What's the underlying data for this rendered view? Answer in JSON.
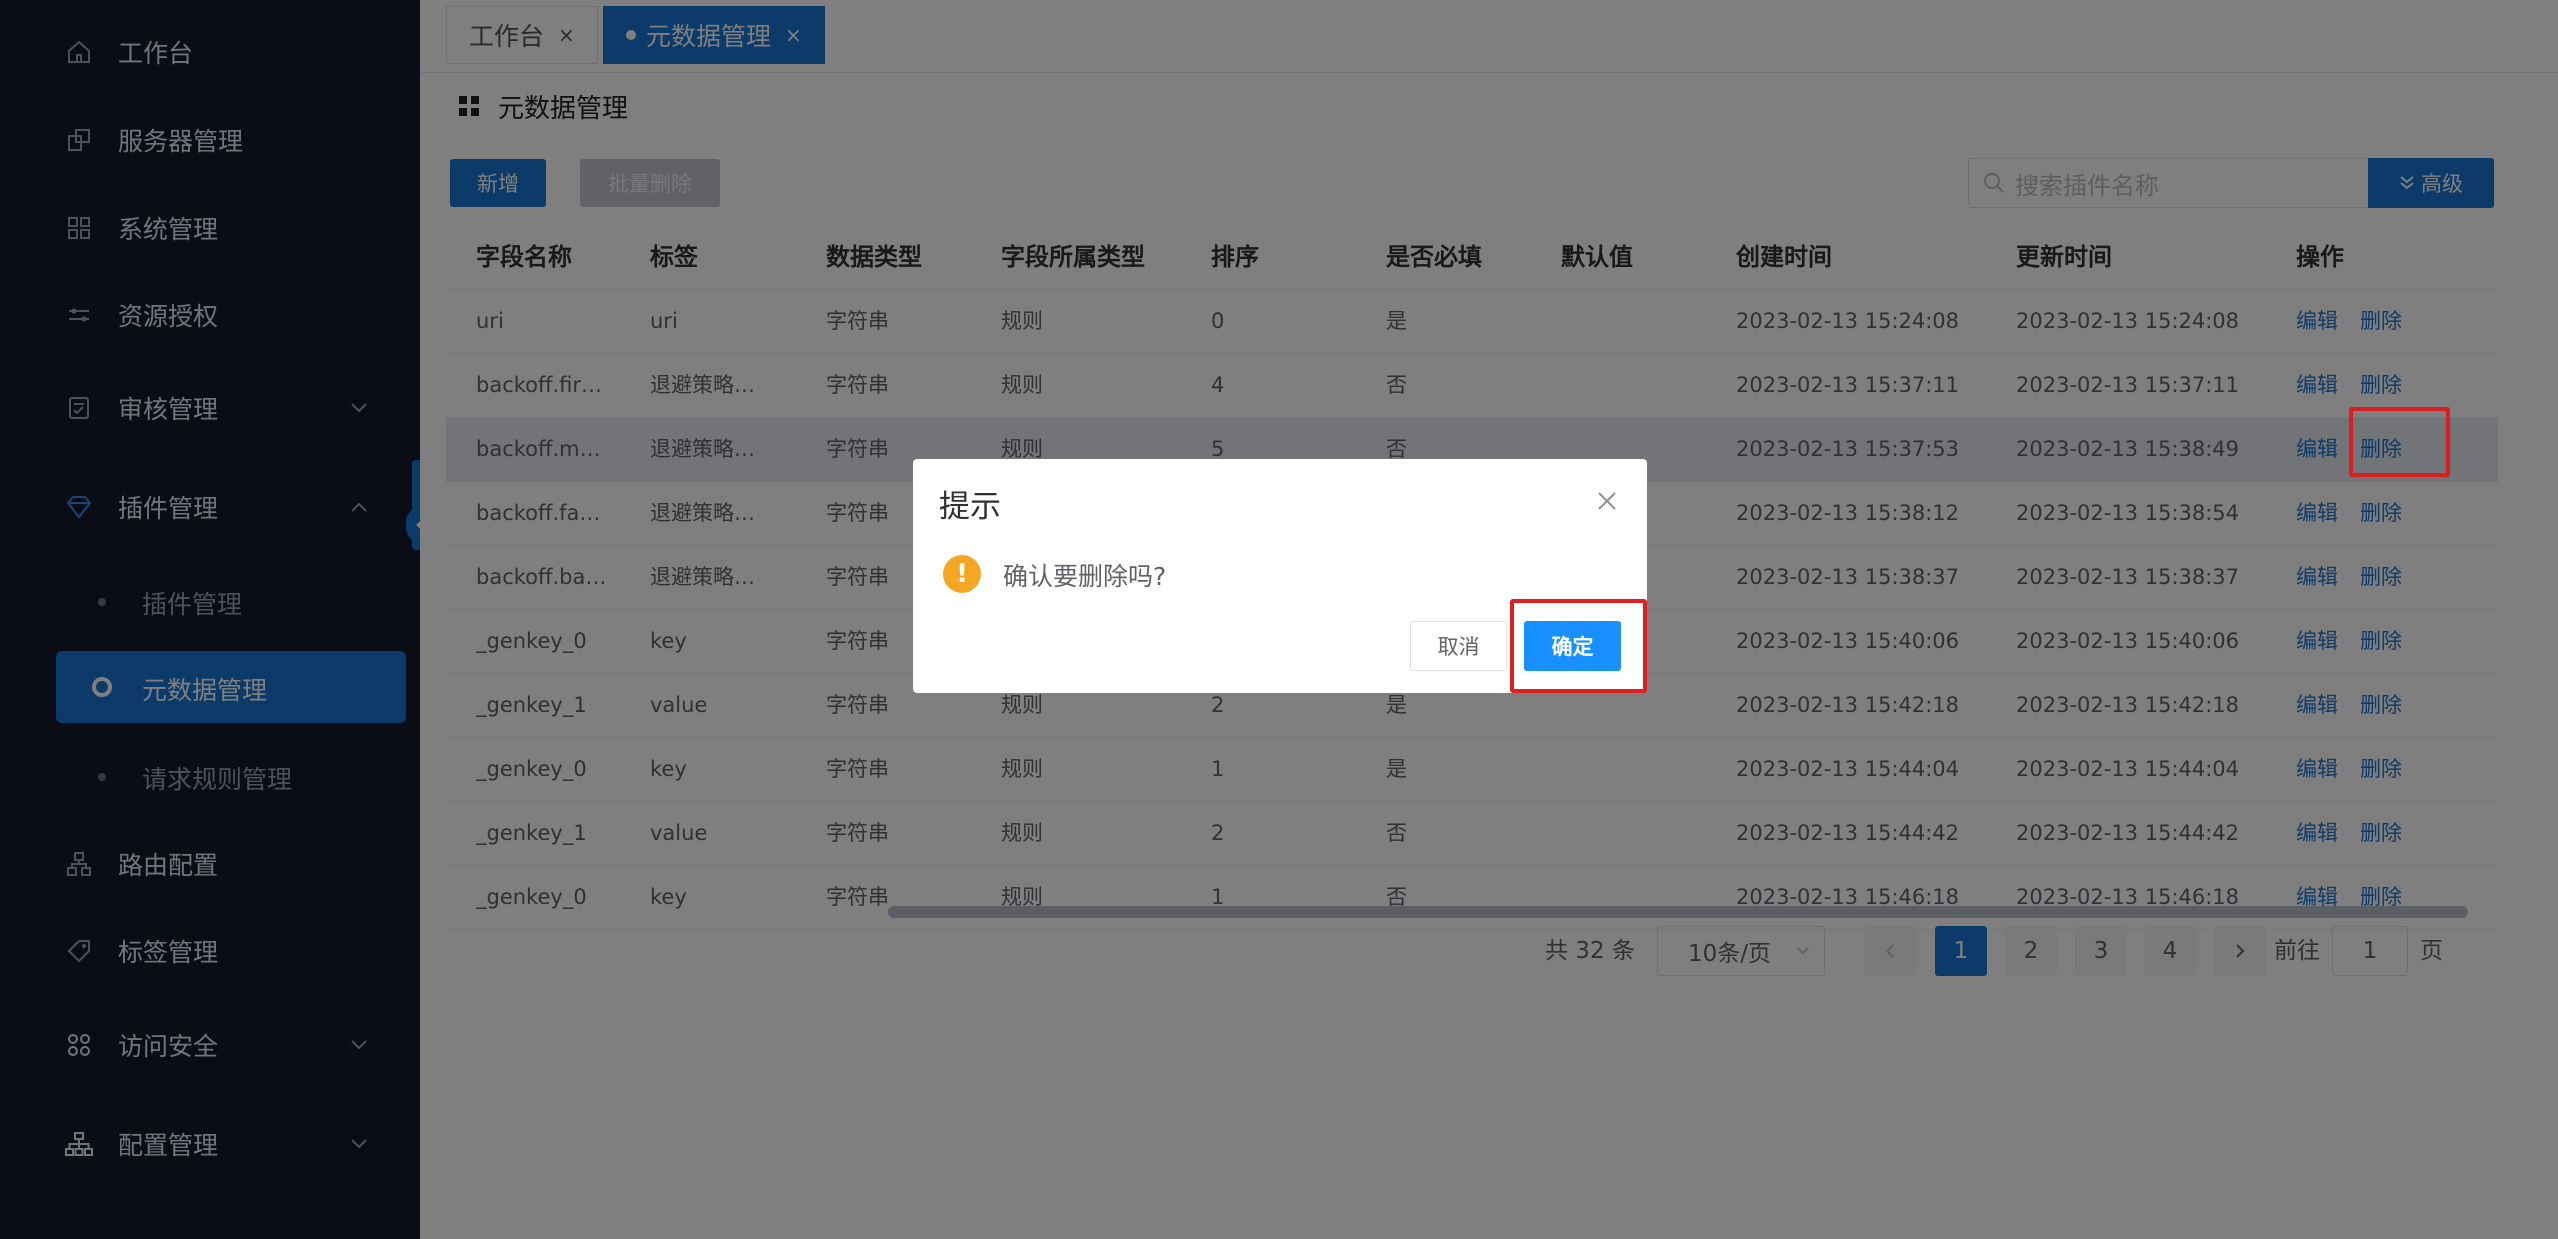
{
  "tabs": [
    {
      "label": "工作台"
    },
    {
      "label": "元数据管理"
    }
  ],
  "tab_close": "×",
  "sidebar": {
    "items": [
      {
        "label": "工作台",
        "icon": "home-icon"
      },
      {
        "label": "服务器管理",
        "icon": "server-icon"
      },
      {
        "label": "系统管理",
        "icon": "grid-icon"
      },
      {
        "label": "资源授权",
        "icon": "resource-icon"
      },
      {
        "label": "审核管理",
        "icon": "audit-icon"
      },
      {
        "label": "插件管理",
        "icon": "diamond-icon"
      },
      {
        "label": "路由配置",
        "icon": "route-icon"
      },
      {
        "label": "标签管理",
        "icon": "tag-icon"
      },
      {
        "label": "访问安全",
        "icon": "apps-icon"
      },
      {
        "label": "配置管理",
        "icon": "org-icon"
      }
    ],
    "sub_items": [
      {
        "label": "插件管理"
      },
      {
        "label": "元数据管理"
      },
      {
        "label": "请求规则管理"
      }
    ]
  },
  "page": {
    "title": "元数据管理"
  },
  "toolbar": {
    "add_label": "新增",
    "batch_delete_label": "批量删除",
    "search_placeholder": "搜索插件名称",
    "advanced_label": "高级"
  },
  "table": {
    "headers": [
      "字段名称",
      "标签",
      "数据类型",
      "字段所属类型",
      "排序",
      "是否必填",
      "默认值",
      "创建时间",
      "更新时间",
      "操作"
    ],
    "edit_label": "编辑",
    "delete_label": "删除",
    "rows": [
      [
        "uri",
        "uri",
        "字符串",
        "规则",
        "0",
        "是",
        "",
        "2023-02-13 15:24:08",
        "2023-02-13 15:24:08"
      ],
      [
        "backoff.fir…",
        "退避策略…",
        "字符串",
        "规则",
        "4",
        "否",
        "",
        "2023-02-13 15:37:11",
        "2023-02-13 15:37:11"
      ],
      [
        "backoff.m…",
        "退避策略…",
        "字符串",
        "规则",
        "5",
        "否",
        "",
        "2023-02-13 15:37:53",
        "2023-02-13 15:38:49"
      ],
      [
        "backoff.fa…",
        "退避策略…",
        "字符串",
        "",
        "",
        "",
        "",
        "2023-02-13 15:38:12",
        "2023-02-13 15:38:54"
      ],
      [
        "backoff.ba…",
        "退避策略…",
        "字符串",
        "",
        "",
        "",
        "",
        "2023-02-13 15:38:37",
        "2023-02-13 15:38:37"
      ],
      [
        "_genkey_0",
        "key",
        "字符串",
        "",
        "",
        "",
        "",
        "2023-02-13 15:40:06",
        "2023-02-13 15:40:06"
      ],
      [
        "_genkey_1",
        "value",
        "字符串",
        "规则",
        "2",
        "是",
        "",
        "2023-02-13 15:42:18",
        "2023-02-13 15:42:18"
      ],
      [
        "_genkey_0",
        "key",
        "字符串",
        "规则",
        "1",
        "是",
        "",
        "2023-02-13 15:44:04",
        "2023-02-13 15:44:04"
      ],
      [
        "_genkey_1",
        "value",
        "字符串",
        "规则",
        "2",
        "否",
        "",
        "2023-02-13 15:44:42",
        "2023-02-13 15:44:42"
      ],
      [
        "_genkey_0",
        "key",
        "字符串",
        "规则",
        "1",
        "否",
        "",
        "2023-02-13 15:46:18",
        "2023-02-13 15:46:18"
      ]
    ]
  },
  "pagination": {
    "total": "共 32 条",
    "page_size": "10条/页",
    "pages": [
      "1",
      "2",
      "3",
      "4"
    ],
    "goto_label": "前往",
    "goto_value": "1",
    "goto_unit": "页"
  },
  "dialog": {
    "title": "提示",
    "message": "确认要删除吗?",
    "cancel_label": "取消",
    "ok_label": "确定",
    "warn_glyph": "!"
  },
  "colors": {
    "primary": "#1b76d2",
    "sidebar_bg": "#141a2b",
    "highlight": "#e02020",
    "warning": "#f5a623"
  }
}
